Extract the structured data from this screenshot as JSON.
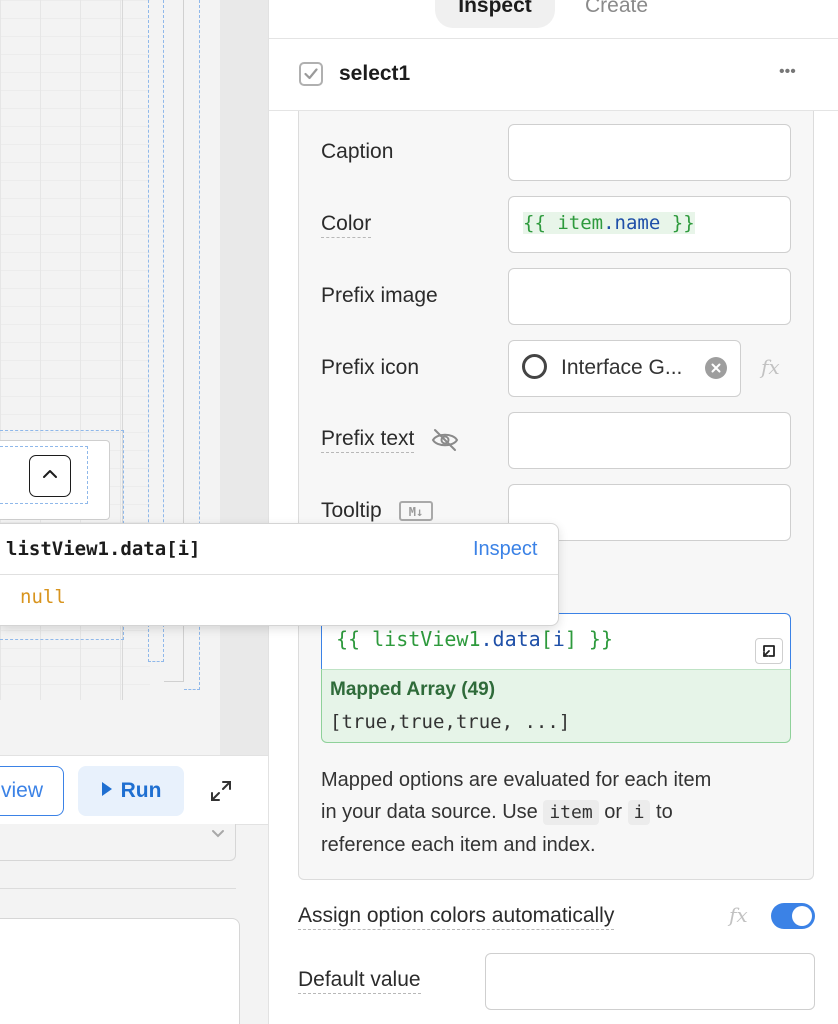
{
  "tabs": {
    "inspect": "Inspect",
    "create": "Create"
  },
  "component": {
    "name": "select1",
    "more_label": "•••"
  },
  "fields": {
    "caption": {
      "label": "Caption",
      "value": ""
    },
    "color": {
      "label": "Color",
      "open": "{{ ",
      "obj": "item",
      "dot": ".",
      "prop": "name",
      "close": " }}"
    },
    "prefix_image": {
      "label": "Prefix image",
      "value": ""
    },
    "prefix_icon": {
      "label": "Prefix icon",
      "value": "Interface G..."
    },
    "prefix_text": {
      "label": "Prefix text",
      "value": ""
    },
    "tooltip": {
      "label": "Tooltip",
      "badge": "M↓",
      "value": ""
    }
  },
  "code_editor": {
    "open": "{{ ",
    "obj": "listView1",
    "dot": ".",
    "prop": "data",
    "lb": "[",
    "idx": "i",
    "rb": "]",
    "close": " }}"
  },
  "mapped": {
    "title": "Mapped Array (49)",
    "value": "[true,true,true, ...]"
  },
  "help": {
    "line1": "Mapped options are evaluated for each item",
    "l2a": "in your data source. Use ",
    "code1": "item",
    "l2b": " or ",
    "code2": "i",
    "l2c": " to",
    "line3": "reference each item and index."
  },
  "assign_colors": {
    "label": "Assign option colors automatically",
    "enabled": true
  },
  "default_value": {
    "label": "Default value",
    "value": ""
  },
  "fx_label": "fx",
  "popover": {
    "expr": "listView1.data[i]",
    "inspect": "Inspect",
    "value": "null"
  },
  "query_bar": {
    "preview": "view",
    "run": "Run"
  },
  "colors": {
    "accent": "#3b82e6",
    "string_green": "#2e9a3d",
    "prop_blue": "#1f50a8",
    "mapped_bg": "#e6f4e8",
    "mapped_border": "#8fd19a",
    "null_orange": "#d8941e"
  }
}
